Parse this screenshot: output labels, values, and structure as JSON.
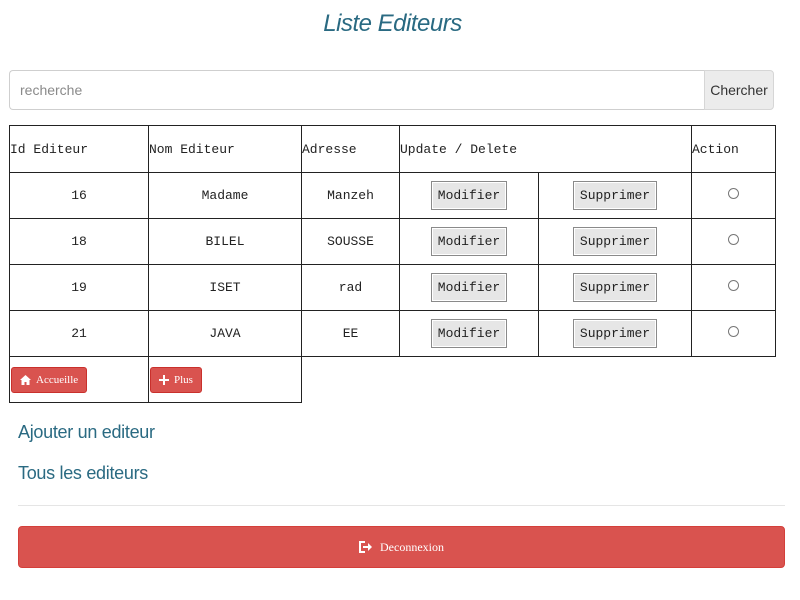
{
  "page": {
    "title": "Liste Editeurs"
  },
  "search": {
    "placeholder": "recherche",
    "value": "",
    "button_label": "Chercher"
  },
  "table": {
    "headers": {
      "id": "Id Editeur",
      "nom": "Nom Editeur",
      "adresse": "Adresse",
      "update_delete": "Update / Delete",
      "action": "Action"
    },
    "rows": [
      {
        "id": "16",
        "nom": "Madame",
        "adresse": "Manzeh"
      },
      {
        "id": "18",
        "nom": "BILEL",
        "adresse": "SOUSSE"
      },
      {
        "id": "19",
        "nom": "ISET",
        "adresse": "rad"
      },
      {
        "id": "21",
        "nom": "JAVA",
        "adresse": "EE"
      }
    ],
    "modifier_label": "Modifier",
    "supprimer_label": "Supprimer"
  },
  "footer_buttons": {
    "accueil_label": "Accueille",
    "plus_label": "Plus"
  },
  "links": {
    "ajouter": "Ajouter un editeur",
    "tous": "Tous les editeurs"
  },
  "logout": {
    "label": "Deconnexion"
  },
  "icons": {
    "home": "home-icon",
    "plus": "plus-icon",
    "logout": "logout-icon"
  },
  "colors": {
    "title": "#2a6a82",
    "danger": "#d9534f",
    "link": "#2a6a82"
  }
}
